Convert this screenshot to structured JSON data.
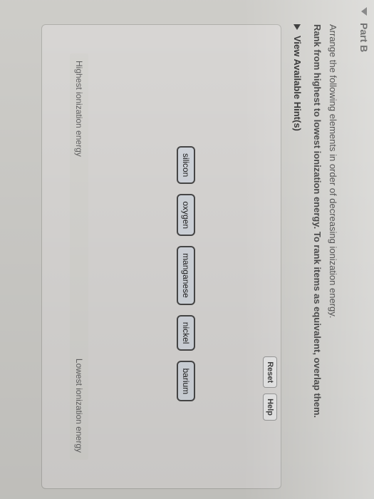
{
  "part": {
    "title": "Part B"
  },
  "question": {
    "line1": "Arrange the following elements in order of decreasing ionization energy.",
    "line2": "Rank from highest to lowest ionization energy. To rank items as equivalent, overlap them."
  },
  "hint": {
    "label": "View Available Hint(s)"
  },
  "buttons": {
    "reset": "Reset",
    "help": "Help"
  },
  "items": [
    "silicon",
    "oxygen",
    "manganese",
    "nickel",
    "barium"
  ],
  "axis": {
    "left": "Highest ionization energy",
    "right": "Lowest ionization energy"
  }
}
